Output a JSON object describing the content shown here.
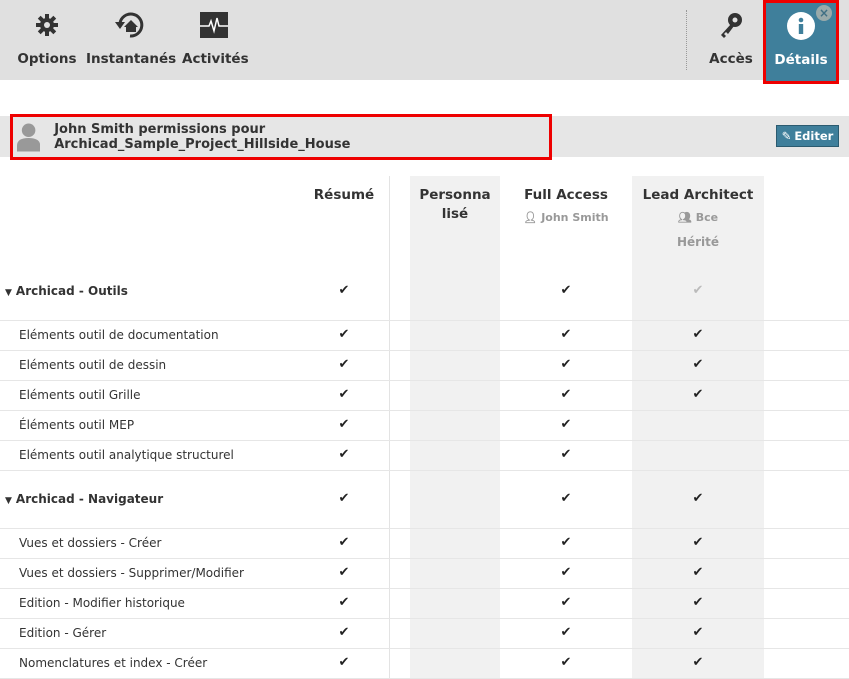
{
  "toolbar": {
    "options": "Options",
    "snapshots": "Instantanés",
    "activities": "Activités",
    "access": "Accès",
    "details": "Détails"
  },
  "header": {
    "title": "John Smith permissions pour Archicad_Sample_Project_Hillside_House",
    "edit": "Editer"
  },
  "columns": {
    "summary": "Résumé",
    "custom_line1": "Personna",
    "custom_line2": "lisé",
    "full": "Full Access",
    "full_user": "John Smith",
    "lead": "Lead Architect",
    "lead_group": "Bce",
    "lead_inherited": "Hérité"
  },
  "rows": [
    {
      "label": "Archicad - Outils",
      "group": true,
      "summary": "check",
      "custom": "",
      "full": "check",
      "lead": "light"
    },
    {
      "label": "Eléments outil de documentation",
      "summary": "check",
      "custom": "",
      "full": "check",
      "lead": "check"
    },
    {
      "label": "Eléments outil de dessin",
      "summary": "check",
      "custom": "",
      "full": "check",
      "lead": "check"
    },
    {
      "label": "Eléments outil Grille",
      "summary": "check",
      "custom": "",
      "full": "check",
      "lead": "check"
    },
    {
      "label": "Éléments outil MEP",
      "summary": "check",
      "custom": "",
      "full": "check",
      "lead": ""
    },
    {
      "label": "Eléments outil analytique structurel",
      "summary": "check",
      "custom": "",
      "full": "check",
      "lead": ""
    },
    {
      "label": "Archicad - Navigateur",
      "group": true,
      "summary": "check",
      "custom": "",
      "full": "check",
      "lead": "check"
    },
    {
      "label": "Vues et dossiers - Créer",
      "summary": "check",
      "custom": "",
      "full": "check",
      "lead": "check"
    },
    {
      "label": "Vues et dossiers - Supprimer/Modifier",
      "summary": "check",
      "custom": "",
      "full": "check",
      "lead": "check"
    },
    {
      "label": "Edition - Modifier historique",
      "summary": "check",
      "custom": "",
      "full": "check",
      "lead": "check"
    },
    {
      "label": "Edition - Gérer",
      "summary": "check",
      "custom": "",
      "full": "check",
      "lead": "check"
    },
    {
      "label": "Nomenclatures et index - Créer",
      "summary": "check",
      "custom": "",
      "full": "check",
      "lead": "check"
    }
  ]
}
